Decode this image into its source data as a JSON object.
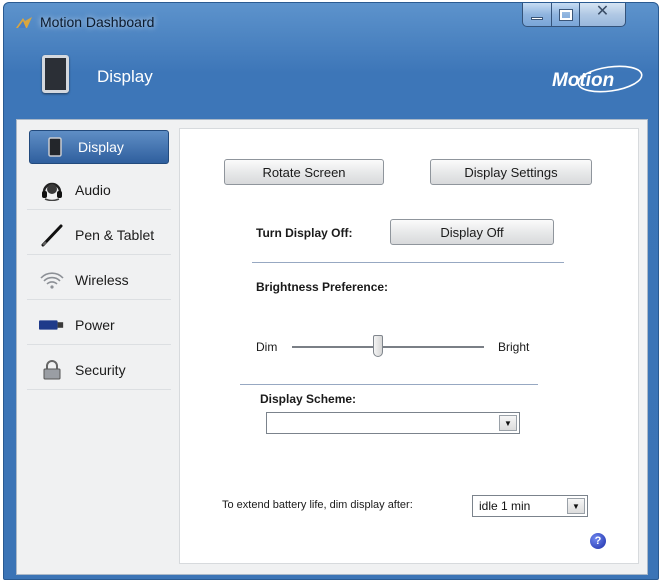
{
  "window": {
    "title": "Motion Dashboard"
  },
  "header": {
    "title": "Display",
    "brand": "Motion"
  },
  "sidebar": {
    "items": [
      {
        "label": "Display",
        "icon": "tablet-icon",
        "active": true
      },
      {
        "label": "Audio",
        "icon": "headset-icon",
        "active": false
      },
      {
        "label": "Pen & Tablet",
        "icon": "pen-icon",
        "active": false
      },
      {
        "label": "Wireless",
        "icon": "wireless-icon",
        "active": false
      },
      {
        "label": "Power",
        "icon": "battery-icon",
        "active": false
      },
      {
        "label": "Security",
        "icon": "lock-icon",
        "active": false
      }
    ]
  },
  "display_panel": {
    "rotate_screen_label": "Rotate Screen",
    "display_settings_label": "Display Settings",
    "turn_display_off_label": "Turn Display Off:",
    "display_off_label": "Display Off",
    "brightness_label": "Brightness Preference:",
    "dim_label": "Dim",
    "bright_label": "Bright",
    "brightness_level": 0.5,
    "display_scheme_label": "Display Scheme:",
    "display_scheme_value": "",
    "battery_hint_label": "To extend battery life, dim display after:",
    "dim_after_value": "idle 1 min"
  },
  "colors": {
    "frame": "#3d76b8",
    "active_item": "#2f5f9e",
    "help": "#1d2fa8"
  }
}
